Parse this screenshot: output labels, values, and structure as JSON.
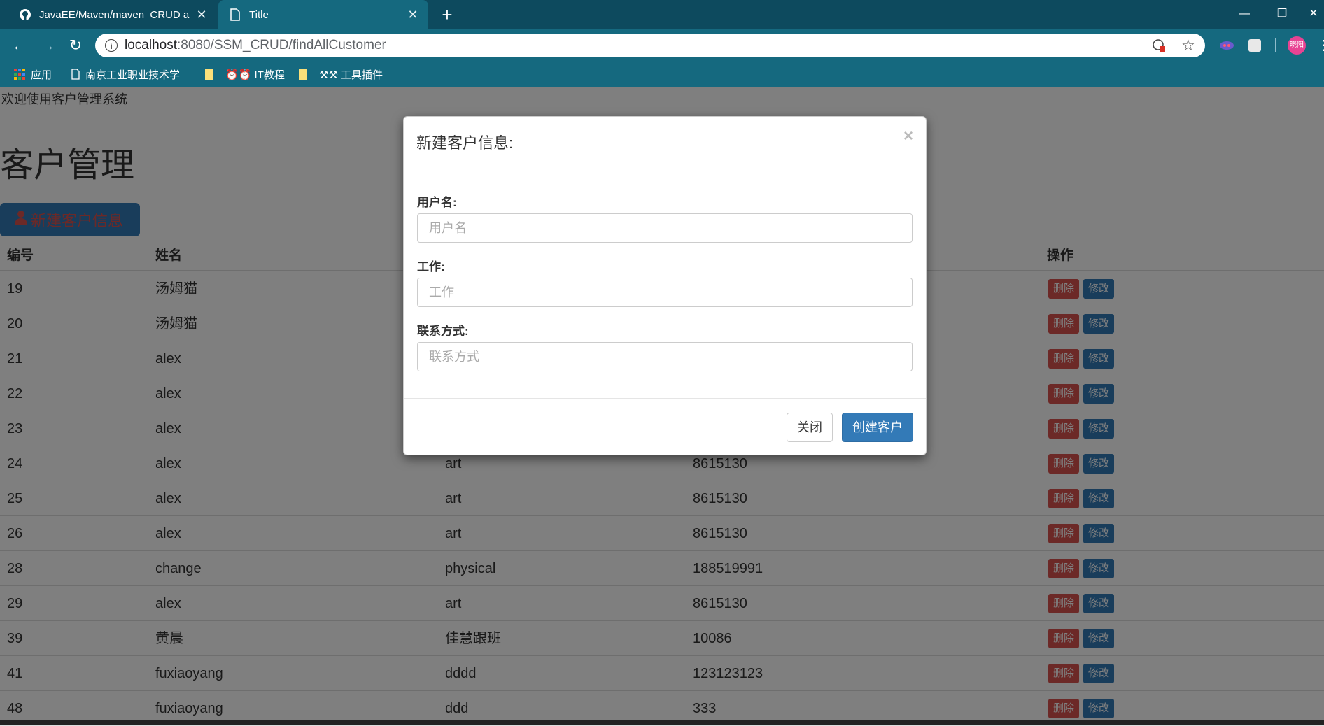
{
  "browser": {
    "tabs": [
      {
        "title": "JavaEE/Maven/maven_CRUD a",
        "icon": "github-icon",
        "active": false
      },
      {
        "title": "Title",
        "icon": "document-icon",
        "active": true
      }
    ],
    "url_host": "localhost",
    "url_path": ":8080/SSM_CRUD/findAllCustomer",
    "bookmarks": [
      {
        "label": "应用",
        "icon": "apps-grid-icon"
      },
      {
        "label": "南京工业职业技术学",
        "icon": "document-icon"
      },
      {
        "label": "",
        "icon": "folder-icon"
      },
      {
        "label": "⏰⏰ IT教程",
        "icon": "folder-icon"
      },
      {
        "label": "⚒⚒ 工具插件",
        "icon": "folder-icon"
      }
    ],
    "profile_initials": "晓阳"
  },
  "page": {
    "welcome": "欢迎使用客户管理系统",
    "title": "客户管理",
    "add_button_label": "新建客户信息",
    "columns": [
      "编号",
      "姓名",
      "操作"
    ],
    "delete_label": "删除",
    "edit_label": "修改",
    "rows": [
      {
        "id": "19",
        "name": "汤姆猫",
        "job": "",
        "phone": ""
      },
      {
        "id": "20",
        "name": "汤姆猫",
        "job": "",
        "phone": ""
      },
      {
        "id": "21",
        "name": "alex",
        "job": "",
        "phone": ""
      },
      {
        "id": "22",
        "name": "alex",
        "job": "",
        "phone": ""
      },
      {
        "id": "23",
        "name": "alex",
        "job": "",
        "phone": ""
      },
      {
        "id": "24",
        "name": "alex",
        "job": "art",
        "phone": "8615130"
      },
      {
        "id": "25",
        "name": "alex",
        "job": "art",
        "phone": "8615130"
      },
      {
        "id": "26",
        "name": "alex",
        "job": "art",
        "phone": "8615130"
      },
      {
        "id": "28",
        "name": "change",
        "job": "physical",
        "phone": "188519991"
      },
      {
        "id": "29",
        "name": "alex",
        "job": "art",
        "phone": "8615130"
      },
      {
        "id": "39",
        "name": "黄晨",
        "job": "佳慧跟班",
        "phone": "10086"
      },
      {
        "id": "41",
        "name": "fuxiaoyang",
        "job": "dddd",
        "phone": "123123123"
      },
      {
        "id": "48",
        "name": "fuxiaoyang",
        "job": "ddd",
        "phone": "333"
      }
    ]
  },
  "modal": {
    "title": "新建客户信息:",
    "close_glyph": "×",
    "fields": [
      {
        "label": "用户名:",
        "placeholder": "用户名",
        "value": ""
      },
      {
        "label": "工作:",
        "placeholder": "工作",
        "value": ""
      },
      {
        "label": "联系方式:",
        "placeholder": "联系方式",
        "value": ""
      }
    ],
    "close_button": "关闭",
    "create_button": "创建客户"
  },
  "colors": {
    "chrome_dark": "#0d4a5e",
    "chrome_light": "#15697f",
    "primary": "#337ab7",
    "danger": "#d9534f"
  }
}
